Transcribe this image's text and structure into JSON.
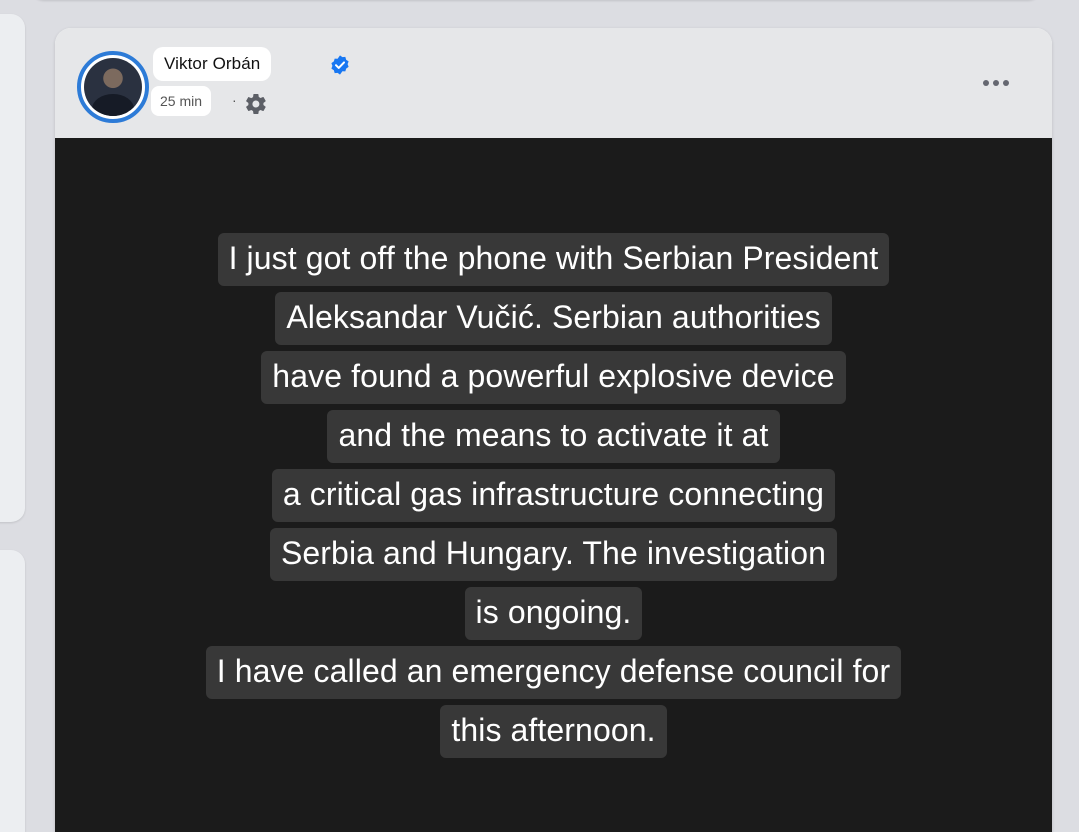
{
  "post": {
    "author": "Viktor Orbán",
    "verified": true,
    "time": "25 min",
    "separator": "·",
    "audience_icon": "gear-icon",
    "more_icon": "more-options-icon",
    "accent_color": "#2d7bd7",
    "media": {
      "lines": [
        "I just got off the phone with Serbian President",
        "Aleksandar Vučić. Serbian authorities",
        "have found a powerful explosive device",
        "and the means to activate it at",
        "a critical gas infrastructure connecting",
        "Serbia and Hungary. The investigation",
        "is ongoing.",
        "I have called an emergency defense council for",
        "this afternoon."
      ]
    }
  }
}
